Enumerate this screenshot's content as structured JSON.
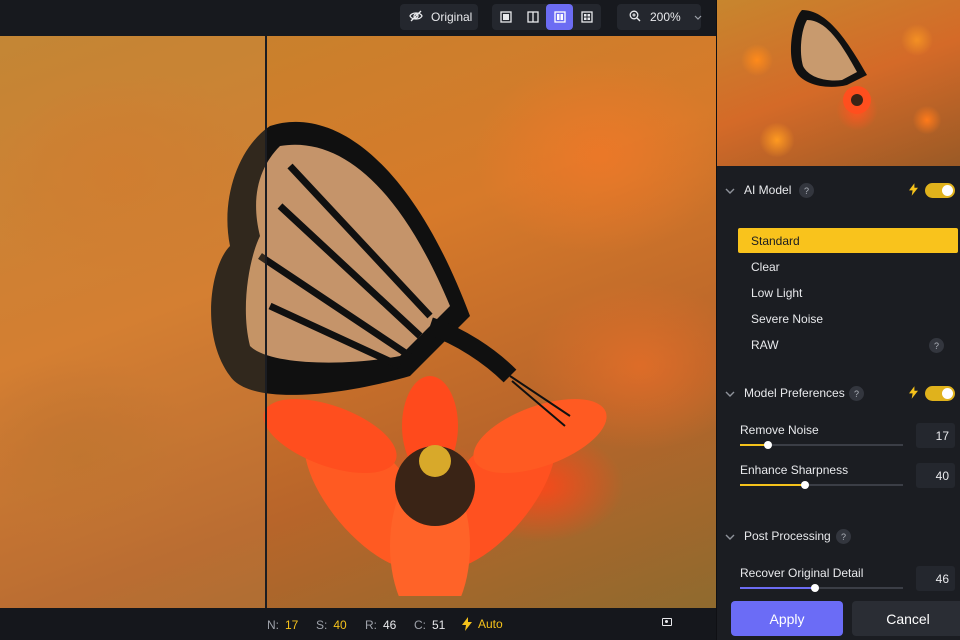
{
  "toolbar": {
    "original_label": "Original",
    "view_modes": [
      "single-view",
      "split-view",
      "side-by-side",
      "grid-view"
    ],
    "active_view": "side-by-side",
    "zoom_label": "200%"
  },
  "colors": {
    "accent": "#6c6cf3",
    "highlight": "#f9c31c",
    "panel_bg": "#1b1d22",
    "toolbar_bg": "#17191e"
  },
  "status": {
    "n_label": "N:",
    "n_value": "17",
    "s_label": "S:",
    "s_value": "40",
    "r_label": "R:",
    "r_value": "46",
    "c_label": "C:",
    "c_value": "51",
    "auto_label": "Auto"
  },
  "panel": {
    "ai_model": {
      "title": "AI Model",
      "help": "?",
      "enabled": true,
      "options": [
        "Standard",
        "Clear",
        "Low Light",
        "Severe Noise",
        "RAW"
      ],
      "selected": "Standard",
      "raw_help": "?"
    },
    "model_preferences": {
      "title": "Model Preferences",
      "help": "?",
      "enabled": true,
      "sliders": [
        {
          "label": "Remove Noise",
          "value": "17",
          "fraction": 0.17
        },
        {
          "label": "Enhance Sharpness",
          "value": "40",
          "fraction": 0.4
        }
      ]
    },
    "post_processing": {
      "title": "Post Processing",
      "help": "?",
      "sliders": [
        {
          "label": "Recover Original Detail",
          "value": "46",
          "fraction": 0.46
        }
      ]
    },
    "apply_label": "Apply",
    "cancel_label": "Cancel"
  }
}
